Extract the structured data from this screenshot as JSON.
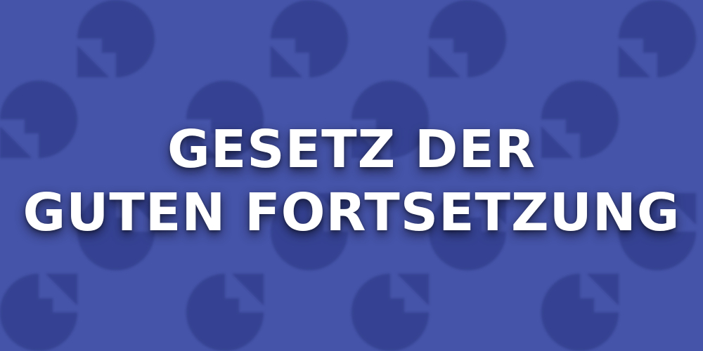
{
  "headline": {
    "line1": "GESETZ DER",
    "line2": "GUTEN FORTSETZUNG"
  },
  "colors": {
    "background": "#4553a8",
    "pattern": "#33408f",
    "text": "#ffffff"
  },
  "background_icon": "circle-arrow-icon"
}
